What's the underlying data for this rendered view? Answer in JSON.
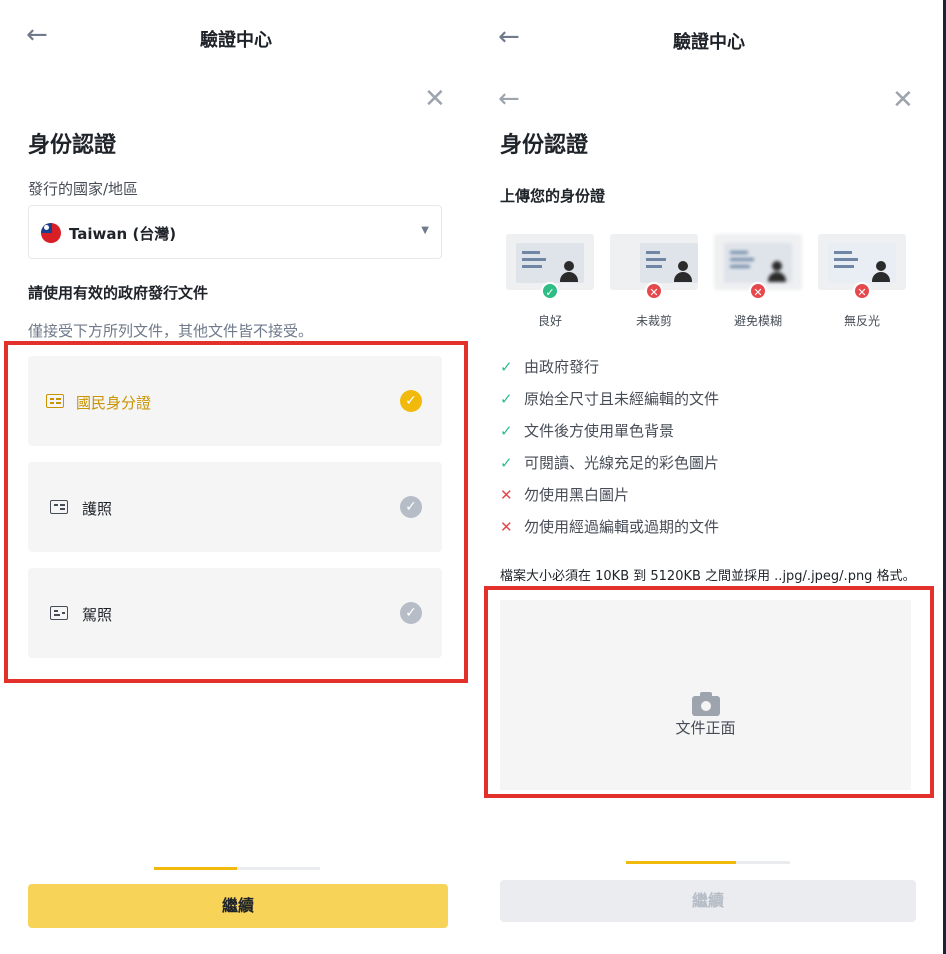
{
  "left": {
    "back_icon": "arrow-left-icon",
    "title": "驗證中心",
    "close_icon": "close-icon",
    "heading": "身份認證",
    "country_label": "發行的國家/地區",
    "country_value": "Taiwan (台灣)",
    "dropdown_icon": "triangle-down-icon",
    "docs_title": "請使用有效的政府發行文件",
    "docs_hint": "僅接受下方所列文件，其他文件皆不接受。",
    "documents": [
      {
        "label": "國民身分證",
        "selected": true,
        "icon": "id-card-icon"
      },
      {
        "label": "護照",
        "selected": false,
        "icon": "passport-icon"
      },
      {
        "label": "駕照",
        "selected": false,
        "icon": "driver-license-icon"
      }
    ],
    "continue_label": "繼續",
    "progress": 0.5
  },
  "right": {
    "back_icon": "arrow-left-icon",
    "title": "驗證中心",
    "close_icon": "close-icon",
    "heading": "身份認證",
    "upload_title": "上傳您的身份證",
    "examples": [
      {
        "label": "良好",
        "status": "ok"
      },
      {
        "label": "未裁剪",
        "status": "bad"
      },
      {
        "label": "避免模糊",
        "status": "bad"
      },
      {
        "label": "無反光",
        "status": "bad"
      }
    ],
    "requirements": [
      {
        "text": "由政府發行",
        "ok": true
      },
      {
        "text": "原始全尺寸且未經編輯的文件",
        "ok": true
      },
      {
        "text": "文件後方使用單色背景",
        "ok": true
      },
      {
        "text": "可閱讀、光線充足的彩色圖片",
        "ok": true
      },
      {
        "text": "勿使用黑白圖片",
        "ok": false
      },
      {
        "text": "勿使用經過編輯或過期的文件",
        "ok": false
      }
    ],
    "size_note": "檔案大小必須在 10KB 到 5120KB 之間並採用 ..jpg/.jpeg/.png 格式。",
    "upload_label": "文件正面",
    "camera_icon": "camera-icon",
    "continue_label": "繼續",
    "progress": 0.67
  },
  "colors": {
    "accent": "#f0b90b",
    "button": "#f7d358",
    "selected_text": "#c99400",
    "highlight_box": "#e1312a",
    "ok": "#2ebd85",
    "bad": "#e5484d"
  }
}
